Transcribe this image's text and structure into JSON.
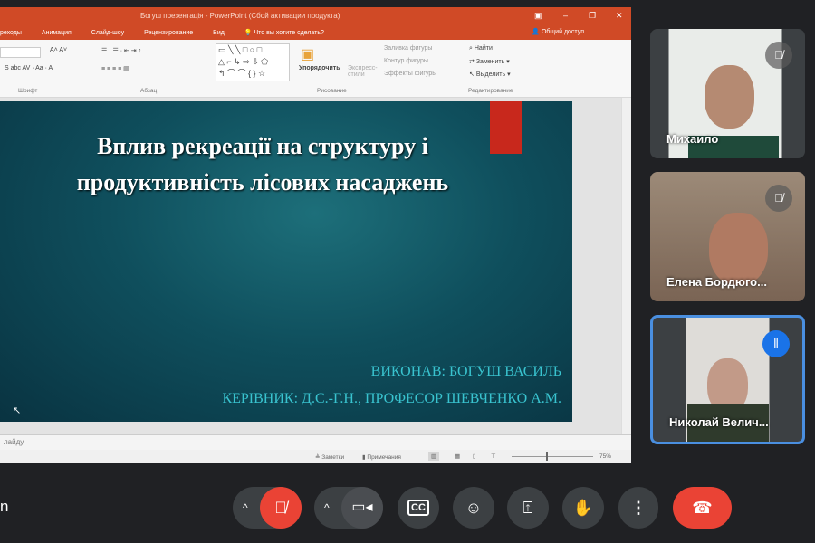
{
  "powerpoint": {
    "window_title": "Богуш презентація - PowerPoint (Сбой активации продукта)",
    "tabs": [
      "реходы",
      "Анимация",
      "Слайд-шоу",
      "Рецензирование",
      "Вид"
    ],
    "tell_me": "Что вы хотите сделать?",
    "share": "Общий доступ",
    "groups": {
      "font": "Шрифт",
      "paragraph": "Абзац",
      "drawing": "Рисование",
      "editing": "Редактирование"
    },
    "drawing": {
      "arrange": "Упорядочить",
      "express_styles": "Экспресс-стили",
      "fill": "Заливка фигуры",
      "outline": "Контур фигуры",
      "effects": "Эффекты фигуры"
    },
    "editing": {
      "find": "Найти",
      "replace": "Заменить",
      "select": "Выделить"
    },
    "slide": {
      "title": "Вплив рекреації на структуру і продуктивність лісових насаджень",
      "author": "ВИКОНАВ: БОГУШ ВАСИЛЬ",
      "supervisor": "КЕРІВНИК: Д.С.-Г.Н., ПРОФЕСОР ШЕВЧЕНКО А.М."
    },
    "notes_placeholder": "лайду",
    "status": {
      "notes": "Заметки",
      "comments": "Примечания",
      "zoom": "75%"
    }
  },
  "participants": [
    {
      "name": "Михаило",
      "muted": true
    },
    {
      "name": "Елена Бордюго...",
      "muted": true
    },
    {
      "name": "Николай Велич...",
      "speaking": true
    }
  ],
  "meeting": {
    "label": "n"
  },
  "colors": {
    "ppt_orange": "#d04a26",
    "end_call": "#ea4335",
    "speaking": "#1a73e8"
  }
}
